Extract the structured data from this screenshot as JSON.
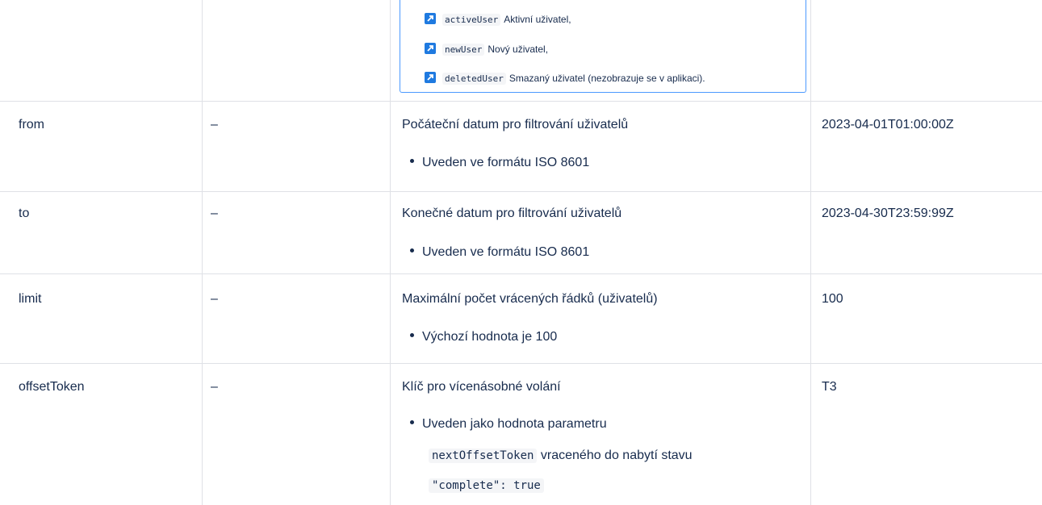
{
  "enum_panel": {
    "items": [
      {
        "code": "activeUser",
        "text": "Aktivní uživatel,",
        "icon": "link-arrow-icon"
      },
      {
        "code": "newUser",
        "text": "Nový uživatel,",
        "icon": "link-arrow-icon"
      },
      {
        "code": "deletedUser",
        "text": "Smazaný uživatel (nezobrazuje se v aplikaci).",
        "icon": "link-arrow-icon"
      }
    ]
  },
  "rows": [
    {
      "name": "from",
      "required": "–",
      "description": "Počáteční datum pro filtrování uživatelů",
      "bullet": "Uveden ve formátu ISO 8601",
      "example": "2023-04-01T01:00:00Z"
    },
    {
      "name": "to",
      "required": "–",
      "description": "Konečné datum pro filtrování uživatelů",
      "bullet": "Uveden ve formátu ISO 8601",
      "example": "2023-04-30T23:59:99Z"
    },
    {
      "name": "limit",
      "required": "–",
      "description": "Maximální počet vrácených řádků (uživatelů)",
      "bullet": "Výchozí hodnota je 100",
      "example": "100"
    },
    {
      "name": "offsetToken",
      "required": "–",
      "description": "Klíč pro vícenásobné volání",
      "bullet_line1": "Uveden jako hodnota parametru",
      "bullet_code1": "nextOffsetToken",
      "bullet_line2": "vraceného do nabytí stavu",
      "bullet_code2": "\"complete\": true",
      "example": "T3"
    }
  ]
}
